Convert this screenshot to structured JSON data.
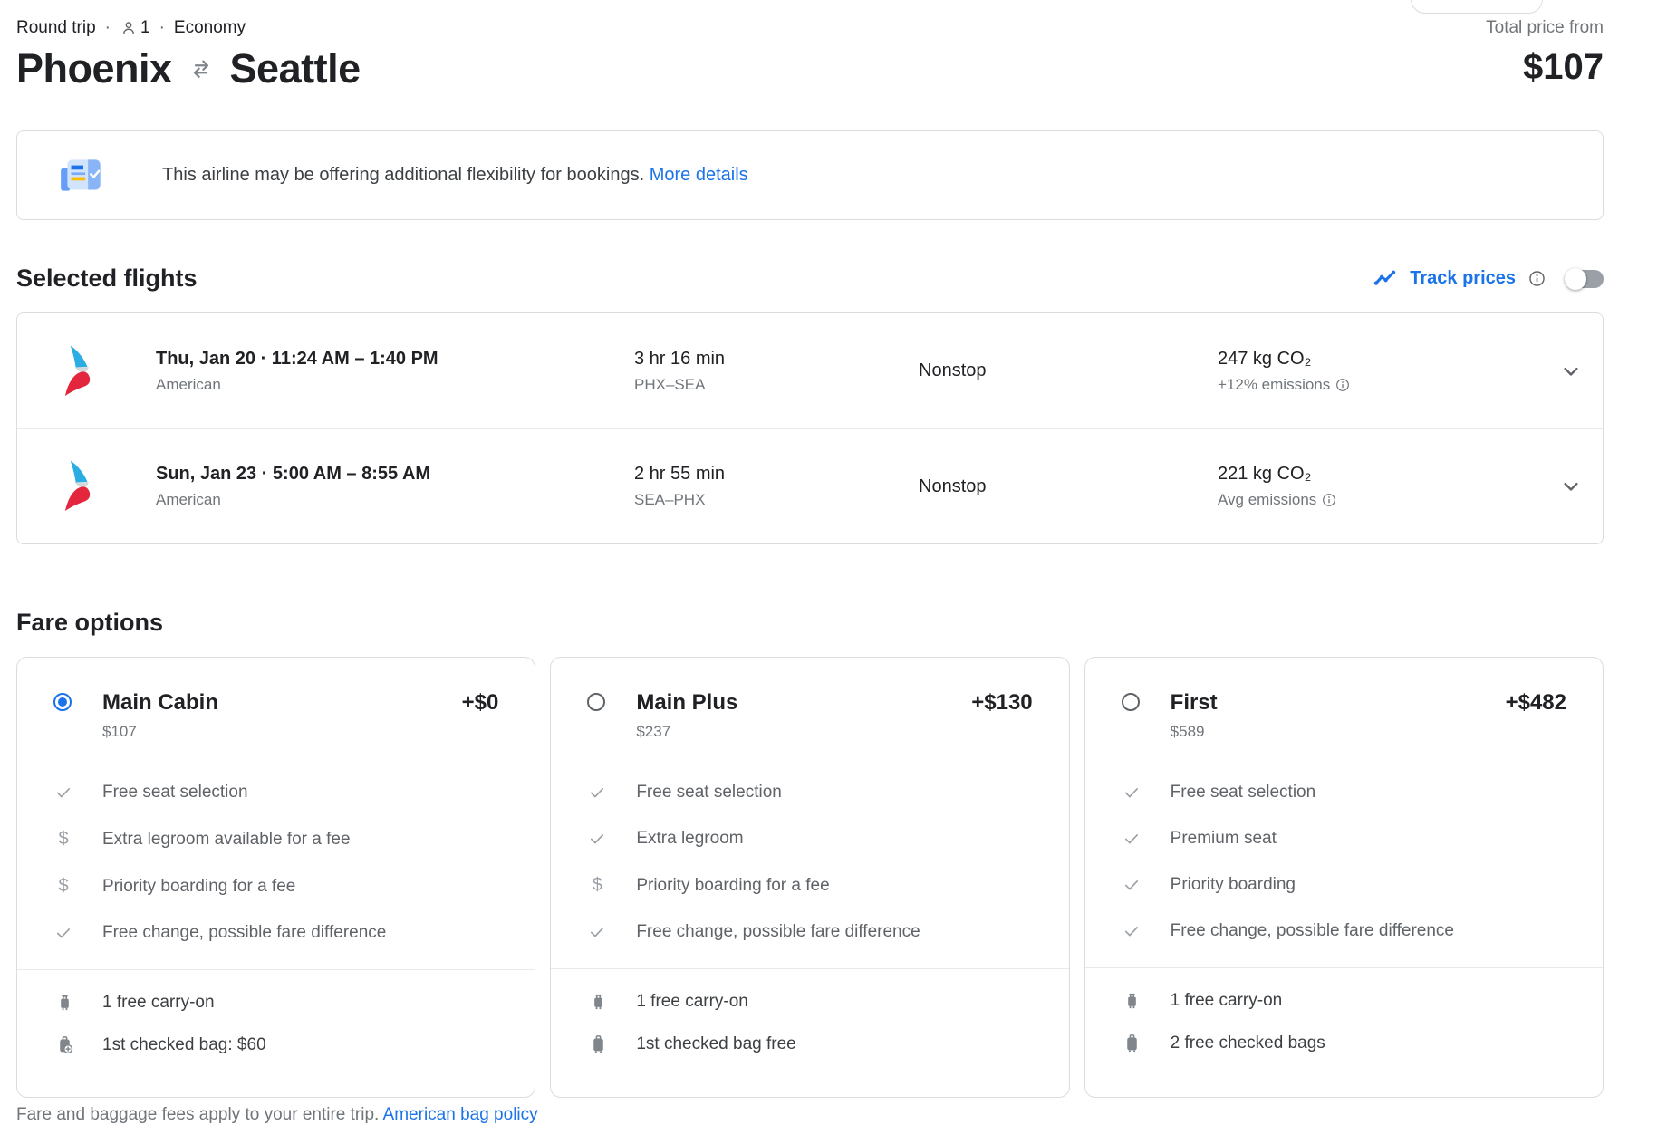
{
  "header": {
    "trip_type": "Round trip",
    "sep": "·",
    "passenger_count": "1",
    "cabin_class": "Economy",
    "origin": "Phoenix",
    "destination": "Seattle",
    "total_price_label": "Total price from",
    "total_price": "$107"
  },
  "banner": {
    "message": "This airline may be offering additional flexibility for bookings.",
    "link_label": "More details"
  },
  "selected_flights": {
    "title": "Selected flights",
    "track_prices_label": "Track prices",
    "flights": [
      {
        "label": "Thu, Jan 20 · 11:24 AM – 1:40 PM",
        "airline": "American",
        "duration": "3 hr 16 min",
        "route": "PHX–SEA",
        "stops": "Nonstop",
        "co2": "247 kg CO₂",
        "emissions": "+12% emissions"
      },
      {
        "label": "Sun, Jan 23 · 5:00 AM – 8:55 AM",
        "airline": "American",
        "duration": "2 hr 55 min",
        "route": "SEA–PHX",
        "stops": "Nonstop",
        "co2": "221 kg CO₂",
        "emissions": "Avg emissions"
      }
    ]
  },
  "fare_options": {
    "title": "Fare options",
    "icons": {
      "fee_glyph": "$"
    },
    "cards": [
      {
        "name": "Main Cabin",
        "price": "$107",
        "delta": "+$0",
        "selected": true,
        "features": [
          {
            "icon": "check",
            "text": "Free seat selection"
          },
          {
            "icon": "fee",
            "text": "Extra legroom available for a fee"
          },
          {
            "icon": "fee",
            "text": "Priority boarding for a fee"
          },
          {
            "icon": "check",
            "text": "Free change, possible fare difference"
          }
        ],
        "bags": [
          {
            "icon": "carry-on",
            "text": "1 free carry-on"
          },
          {
            "icon": "checked-add",
            "text": "1st checked bag: $60"
          }
        ]
      },
      {
        "name": "Main Plus",
        "price": "$237",
        "delta": "+$130",
        "selected": false,
        "features": [
          {
            "icon": "check",
            "text": "Free seat selection"
          },
          {
            "icon": "check",
            "text": "Extra legroom"
          },
          {
            "icon": "fee",
            "text": "Priority boarding for a fee"
          },
          {
            "icon": "check",
            "text": "Free change, possible fare difference"
          }
        ],
        "bags": [
          {
            "icon": "carry-on",
            "text": "1 free carry-on"
          },
          {
            "icon": "checked",
            "text": "1st checked bag free"
          }
        ]
      },
      {
        "name": "First",
        "price": "$589",
        "delta": "+$482",
        "selected": false,
        "features": [
          {
            "icon": "check",
            "text": "Free seat selection"
          },
          {
            "icon": "check",
            "text": "Premium seat"
          },
          {
            "icon": "check",
            "text": "Priority boarding"
          },
          {
            "icon": "check",
            "text": "Free change, possible fare difference"
          }
        ],
        "bags": [
          {
            "icon": "carry-on",
            "text": "1 free carry-on"
          },
          {
            "icon": "checked",
            "text": "2 free checked bags"
          }
        ]
      }
    ]
  },
  "footer": {
    "text": "Fare and baggage fees apply to your entire trip.",
    "link_label": "American bag policy"
  },
  "colors": {
    "accent_blue": "#1a73e8",
    "aa_blue": "#2bace2",
    "aa_red": "#e31837",
    "border": "#dadce0"
  }
}
